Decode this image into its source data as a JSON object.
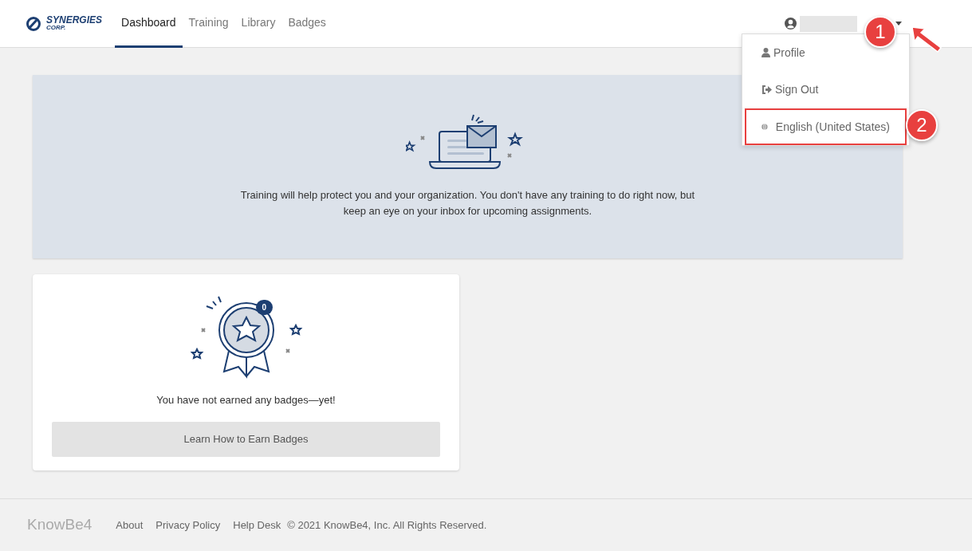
{
  "header": {
    "logo": {
      "name": "SYNERGIES",
      "sub": "CORP."
    },
    "nav": [
      {
        "label": "Dashboard",
        "selected": true
      },
      {
        "label": "Training",
        "selected": false
      },
      {
        "label": "Library",
        "selected": false
      },
      {
        "label": "Badges",
        "selected": false
      }
    ]
  },
  "user_menu": {
    "open": true,
    "items": [
      {
        "kind": "profile",
        "label": "Profile",
        "highlighted": false
      },
      {
        "kind": "signout",
        "label": "Sign Out",
        "highlighted": false
      },
      {
        "kind": "language",
        "label": "English (United States)",
        "highlighted": true
      }
    ]
  },
  "callouts": [
    "1",
    "2"
  ],
  "training_panel": {
    "message": "Training will help protect you and your organization. You don't have any training to do right now, but keep an eye on your inbox for upcoming assignments."
  },
  "badges_card": {
    "count": "0",
    "message": "You have not earned any badges—yet!",
    "button": "Learn How to Earn Badges"
  },
  "footer": {
    "brand": "KnowBe4",
    "links": [
      "About",
      "Privacy Policy",
      "Help Desk"
    ],
    "copyright": "© 2021 KnowBe4, Inc. All Rights Reserved."
  }
}
